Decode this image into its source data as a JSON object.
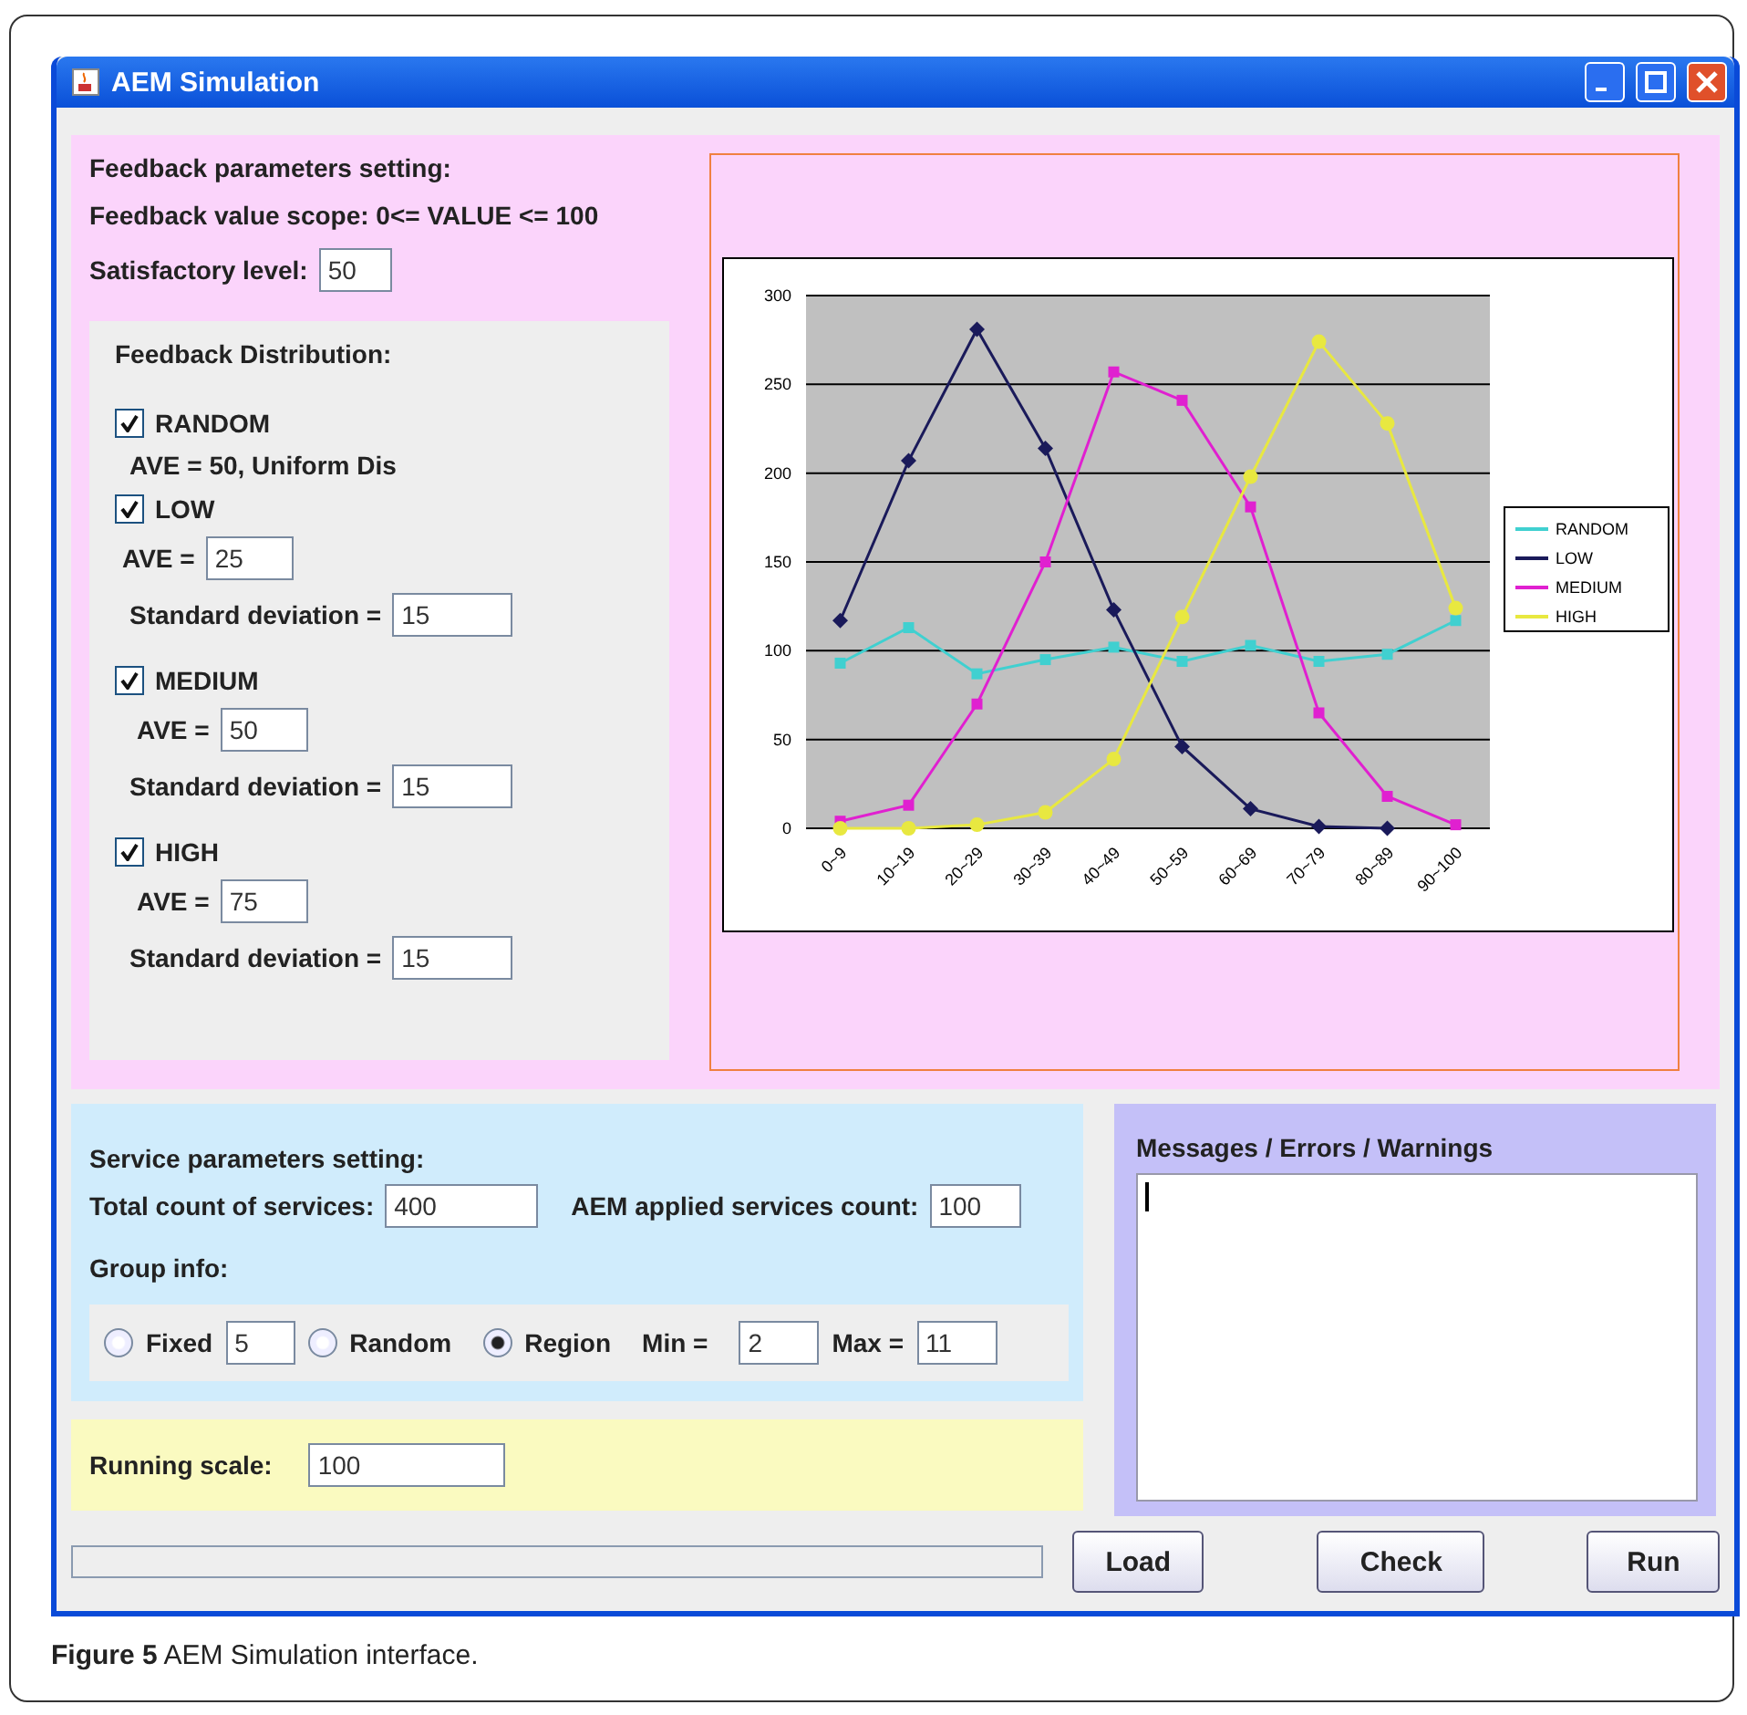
{
  "window": {
    "title": "AEM Simulation"
  },
  "feedback": {
    "heading": "Feedback parameters setting:",
    "scope": "Feedback value scope: 0<= VALUE <= 100",
    "satisfactory": {
      "label": "Satisfactory level:",
      "value": "50"
    },
    "distribution": {
      "heading": "Feedback Distribution:",
      "items": [
        {
          "label": "RANDOM",
          "checked": true,
          "note": "AVE = 50, Uniform Dis"
        },
        {
          "label": "LOW",
          "checked": true,
          "fields": [
            {
              "label": "AVE =",
              "value": "25"
            },
            {
              "label": "Standard deviation =",
              "value": "15"
            }
          ]
        },
        {
          "label": "MEDIUM",
          "checked": true,
          "fields": [
            {
              "label": "AVE =",
              "value": "50"
            },
            {
              "label": "Standard deviation =",
              "value": "15"
            }
          ]
        },
        {
          "label": "HIGH",
          "checked": true,
          "fields": [
            {
              "label": "AVE =",
              "value": "75"
            },
            {
              "label": "Standard deviation =",
              "value": "15"
            }
          ]
        }
      ]
    },
    "chart_data": {
      "type": "line",
      "grid": true,
      "legend": true,
      "categories": [
        "0~9",
        "10~19",
        "20~29",
        "30~39",
        "40~49",
        "50~59",
        "60~69",
        "70~79",
        "80~89",
        "90~100"
      ],
      "ylim": [
        0,
        300
      ],
      "yticks": [
        0,
        50,
        100,
        150,
        200,
        250,
        300
      ],
      "series": [
        {
          "name": "RANDOM",
          "color": "#40d0d0",
          "marker": "square",
          "values": [
            93,
            113,
            87,
            95,
            102,
            94,
            103,
            94,
            98,
            117
          ]
        },
        {
          "name": "LOW",
          "color": "#1a1a5a",
          "marker": "diamond",
          "values": [
            117,
            207,
            281,
            214,
            123,
            46,
            11,
            1,
            0,
            null
          ]
        },
        {
          "name": "MEDIUM",
          "color": "#e020d0",
          "marker": "square",
          "values": [
            4,
            13,
            70,
            150,
            257,
            241,
            181,
            65,
            18,
            2
          ]
        },
        {
          "name": "HIGH",
          "color": "#e8e840",
          "marker": "circle",
          "values": [
            0,
            0,
            2,
            9,
            39,
            119,
            198,
            274,
            228,
            124
          ]
        }
      ]
    }
  },
  "service": {
    "heading": "Service parameters setting:",
    "total": {
      "label": "Total count of services:",
      "value": "400"
    },
    "applied": {
      "label": "AEM applied services count:",
      "value": "100"
    },
    "group_label": "Group info:",
    "options": [
      {
        "label": "Fixed",
        "selected": false,
        "value": "5"
      },
      {
        "label": "Random",
        "selected": false
      },
      {
        "label": "Region",
        "selected": true
      }
    ],
    "range": [
      {
        "label": "Min =",
        "value": "2"
      },
      {
        "label": "Max =",
        "value": "11"
      }
    ]
  },
  "running_scale": {
    "label": "Running scale:",
    "value": "100"
  },
  "messages": {
    "title": "Messages / Errors / Warnings"
  },
  "progress": {
    "level": 0
  },
  "buttons": [
    "Load",
    "Check",
    "Run"
  ],
  "caption": "**Figure 5** AEM Simulation interface."
}
